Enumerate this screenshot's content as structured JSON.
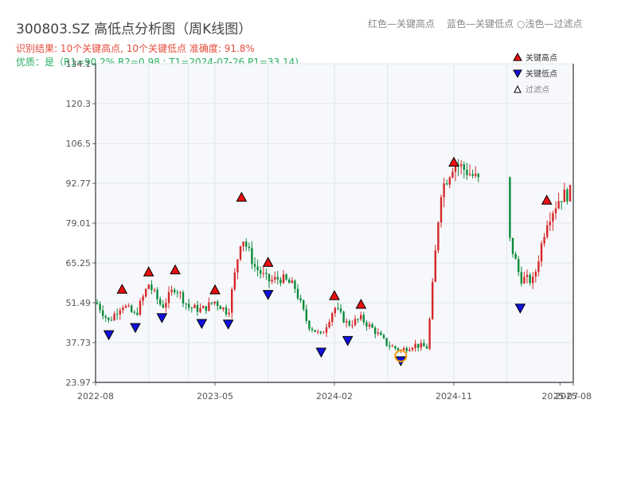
{
  "header": {
    "title": "300803.SZ 高低点分析图（周K线图）",
    "result_line": "识别结果: 10个关键高点, 10个关键低点  准确度: 91.8%",
    "quality_line": "优质：是（R1=90.2%  R2=0.98 ; T1=2024-07-26 P1=33.14)",
    "hints": [
      "红色—关键高点",
      "蓝色—关键低点",
      "○浅色—过滤点"
    ]
  },
  "colors": {
    "up": "#d62728",
    "down": "#0a8a3a",
    "high_marker": "#e81010",
    "low_marker": "#1010e0",
    "filtered_circle": "#f39c12",
    "plot_bg": "#f6f8fb"
  },
  "chart_data": {
    "type": "candlestick",
    "title": "300803.SZ 高低点分析图（周K线图）",
    "ylim": [
      23.97,
      134.1
    ],
    "y_ticks": [
      "134.1",
      "120.3",
      "106.5",
      "92.77",
      "79.01",
      "65.25",
      "51.49",
      "37.73",
      "23.97"
    ],
    "x_ticks": [
      "2022-08",
      "2023-05",
      "2024-02",
      "2024-11",
      "2025-07",
      "2025-08"
    ],
    "grid": true,
    "legend_position": "top-right",
    "legend": [
      {
        "label": "关键高点",
        "marker": "high"
      },
      {
        "label": "关键低点",
        "marker": "low"
      },
      {
        "label": "过滤点",
        "marker": "filtered"
      }
    ],
    "key_highs": [
      {
        "date": "2022-10",
        "price": 54.5
      },
      {
        "date": "2022-12",
        "price": 60.5
      },
      {
        "date": "2023-02",
        "price": 61.2
      },
      {
        "date": "2023-05",
        "price": 54.3
      },
      {
        "date": "2023-07",
        "price": 86.3
      },
      {
        "date": "2023-09",
        "price": 63.8
      },
      {
        "date": "2024-02",
        "price": 52.3
      },
      {
        "date": "2024-04",
        "price": 49.3
      },
      {
        "date": "2024-11",
        "price": 98.4
      },
      {
        "date": "2025-06",
        "price": 85.3
      }
    ],
    "key_lows": [
      {
        "date": "2022-09",
        "price": 42.1
      },
      {
        "date": "2022-11",
        "price": 44.6
      },
      {
        "date": "2023-01",
        "price": 48.0
      },
      {
        "date": "2023-04",
        "price": 46.0
      },
      {
        "date": "2023-06",
        "price": 45.8
      },
      {
        "date": "2023-09",
        "price": 56.0
      },
      {
        "date": "2024-01",
        "price": 36.1
      },
      {
        "date": "2024-03",
        "price": 40.1
      },
      {
        "date": "2024-07",
        "price": 33.1
      },
      {
        "date": "2025-04",
        "price": 51.3
      }
    ],
    "filtered_points": [
      {
        "date": "2024-07",
        "price": 33.14
      }
    ],
    "candles_close_path": [
      {
        "date": "2022-08",
        "close": 52.0
      },
      {
        "date": "2022-09",
        "close": 45.0
      },
      {
        "date": "2022-10",
        "close": 51.0
      },
      {
        "date": "2022-11",
        "close": 47.0
      },
      {
        "date": "2022-12",
        "close": 58.0
      },
      {
        "date": "2023-01",
        "close": 50.0
      },
      {
        "date": "2023-02",
        "close": 57.0
      },
      {
        "date": "2023-03",
        "close": 50.0
      },
      {
        "date": "2023-04",
        "close": 49.0
      },
      {
        "date": "2023-05",
        "close": 52.0
      },
      {
        "date": "2023-06",
        "close": 48.0
      },
      {
        "date": "2023-07",
        "close": 75.0
      },
      {
        "date": "2023-08",
        "close": 64.0
      },
      {
        "date": "2023-09",
        "close": 59.0
      },
      {
        "date": "2023-10",
        "close": 60.0
      },
      {
        "date": "2023-11",
        "close": 57.0
      },
      {
        "date": "2023-12",
        "close": 44.0
      },
      {
        "date": "2024-01",
        "close": 40.0
      },
      {
        "date": "2024-02",
        "close": 50.0
      },
      {
        "date": "2024-03",
        "close": 44.0
      },
      {
        "date": "2024-04",
        "close": 46.0
      },
      {
        "date": "2024-05",
        "close": 42.0
      },
      {
        "date": "2024-06",
        "close": 37.0
      },
      {
        "date": "2024-07",
        "close": 35.0
      },
      {
        "date": "2024-08",
        "close": 37.0
      },
      {
        "date": "2024-09",
        "close": 36.0
      },
      {
        "date": "2024-10",
        "close": 90.0
      },
      {
        "date": "2024-11",
        "close": 100.0
      },
      {
        "date": "2024-12",
        "close": 97.0
      },
      {
        "date": "2025-01",
        "close": 93.0
      },
      {
        "date": "2025-02",
        "close": 93.0
      },
      {
        "date": "2025-04",
        "close": 60.0
      },
      {
        "date": "2025-05",
        "close": 59.0
      },
      {
        "date": "2025-06",
        "close": 80.0
      },
      {
        "date": "2025-07",
        "close": 88.0
      },
      {
        "date": "2025-08",
        "close": 90.0
      }
    ]
  }
}
